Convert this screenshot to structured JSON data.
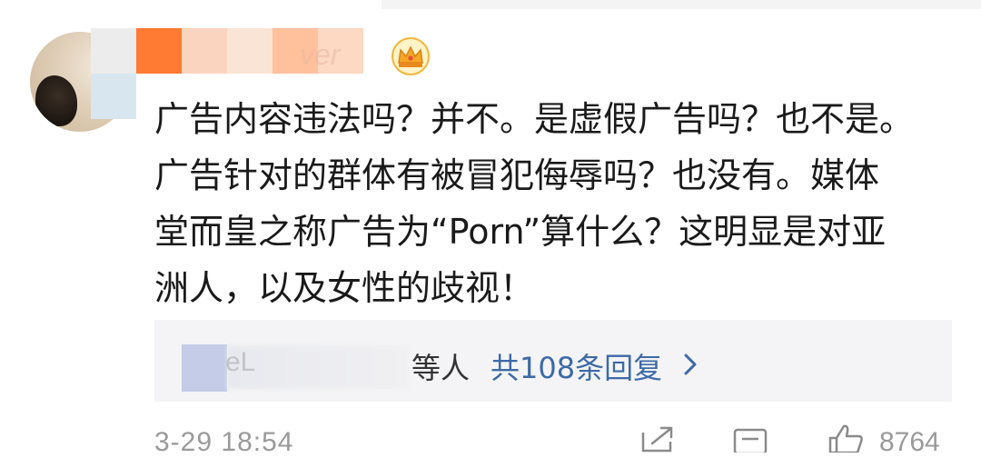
{
  "colors": {
    "link_blue": "#3d6aa6",
    "body_text": "#1a1a1a",
    "muted_text": "#9a9a9a",
    "reply_bg": "#f4f4f6"
  },
  "comment": {
    "username_visible": "ver",
    "badge_icon": "crown-icon",
    "lines": [
      "广告内容违法吗？并不。是虚假广告吗？也不是。",
      "广告针对的群体有被冒犯侮辱吗？也没有。媒体",
      "堂而皇之称广告为“Porn”算什么？这明显是对亚",
      "洲人，以及女性的歧视！"
    ],
    "timestamp": "3-29 18:54"
  },
  "replies": {
    "name_fragment": "eL",
    "others_label": "等人",
    "count_label": "共108条回复",
    "chevron_icon": "chevron-right-icon"
  },
  "actions": {
    "share_icon": "share-icon",
    "comment_icon": "comment-icon",
    "like_icon": "like-icon",
    "like_count": "8764"
  }
}
